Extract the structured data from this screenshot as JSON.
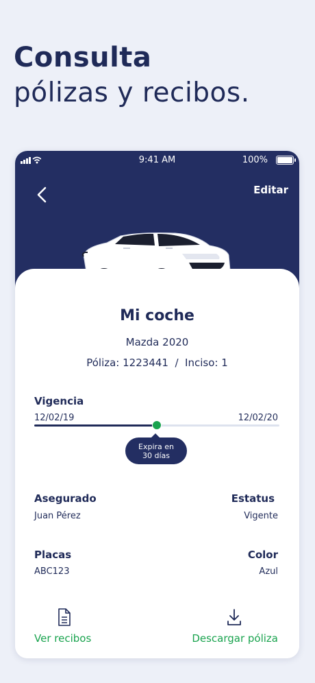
{
  "promo": {
    "line1": "Consulta",
    "line2": "pólizas y recibos."
  },
  "status_bar": {
    "time": "9:41 AM",
    "battery": "100%"
  },
  "header": {
    "edit_label": "Editar"
  },
  "vehicle": {
    "name": "Mi coche",
    "model": "Mazda 2020",
    "policy_line": "Póliza: 1223441  /  Inciso: 1"
  },
  "validity": {
    "label": "Vigencia",
    "start": "12/02/19",
    "end": "12/02/20",
    "progress": 0.5,
    "tooltip_line1": "Expira en",
    "tooltip_line2": "30 días"
  },
  "details": {
    "insured_label": "Asegurado",
    "insured_value": "Juan Pérez",
    "status_label": "Estatus",
    "status_value": "Vigente",
    "plates_label": "Placas",
    "plates_value": "ABC123",
    "color_label": "Color",
    "color_value": "Azul"
  },
  "actions": {
    "receipts_label": "Ver recibos",
    "download_label": "Descargar póliza"
  },
  "colors": {
    "navy": "#232e62",
    "accent_green": "#19a34e",
    "background": "#edf0f8"
  }
}
